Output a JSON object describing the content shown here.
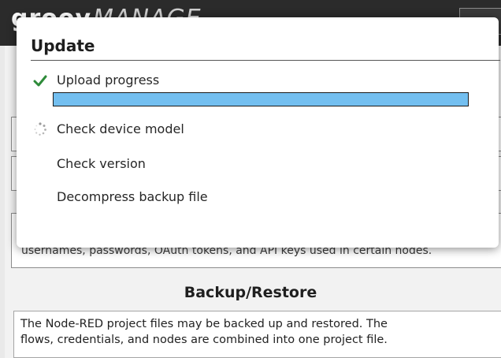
{
  "background": {
    "brand_bold": "groov",
    "brand_light": "MANAGE",
    "clipped_text": "usernames, passwords, OAuth tokens, and API keys used in certain nodes.",
    "section_heading": "Backup/Restore",
    "info_lines": [
      "The Node-RED project files may be backed up and restored. The",
      "flows, credentials, and nodes are combined into one project file."
    ]
  },
  "dialog": {
    "title": "Update",
    "steps": [
      {
        "label": "Upload progress",
        "status": "complete",
        "icon": "checkmark-icon"
      },
      {
        "label": "Check device model",
        "status": "in-progress",
        "icon": "spinner-icon"
      },
      {
        "label": "Check version",
        "status": "pending",
        "icon": ""
      },
      {
        "label": "Decompress backup file",
        "status": "pending",
        "icon": ""
      }
    ],
    "upload_progress": 1.0
  },
  "colors": {
    "check": "#2e8b3a",
    "progress_fill": "#73bff0",
    "spinner": "#9a9a9a"
  }
}
